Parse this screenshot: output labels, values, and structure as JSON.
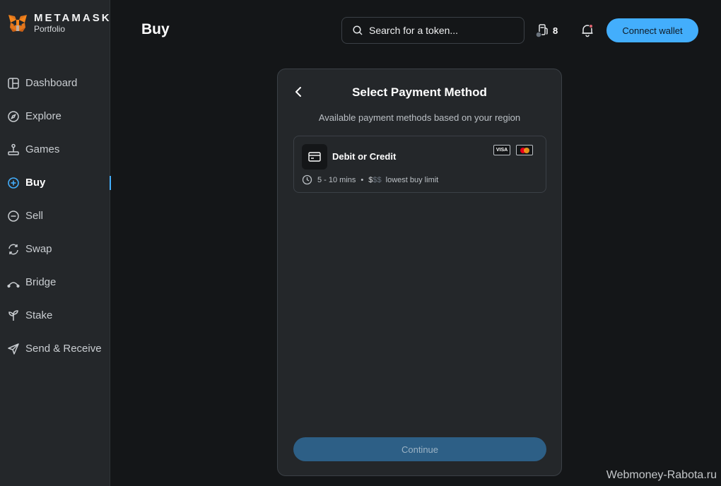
{
  "brand": {
    "name": "METAMASK",
    "sub": "Portfolio"
  },
  "nav": [
    {
      "label": "Dashboard",
      "icon": "dashboard-icon"
    },
    {
      "label": "Explore",
      "icon": "compass-icon"
    },
    {
      "label": "Games",
      "icon": "joystick-icon"
    },
    {
      "label": "Buy",
      "icon": "plus-circle-icon",
      "active": true
    },
    {
      "label": "Sell",
      "icon": "minus-circle-icon"
    },
    {
      "label": "Swap",
      "icon": "swap-icon"
    },
    {
      "label": "Bridge",
      "icon": "bridge-icon"
    },
    {
      "label": "Stake",
      "icon": "sprout-icon"
    },
    {
      "label": "Send & Receive",
      "icon": "send-icon"
    }
  ],
  "header": {
    "title": "Buy",
    "search_placeholder": "Search for a token...",
    "gas_value": "8",
    "connect_label": "Connect wallet"
  },
  "card": {
    "title": "Select Payment Method",
    "subtitle": "Available payment methods based on your region",
    "method": {
      "name": "Debit or Credit",
      "brands": [
        "VISA",
        "mastercard"
      ],
      "time": "5 - 10 mins",
      "cost_active": "$",
      "cost_inactive": "$$",
      "limit": "lowest buy limit"
    },
    "continue_label": "Continue"
  },
  "watermark": "Webmoney-Rabota.ru",
  "colors": {
    "accent": "#43aefc",
    "background": "#141618",
    "surface": "#24272a"
  }
}
